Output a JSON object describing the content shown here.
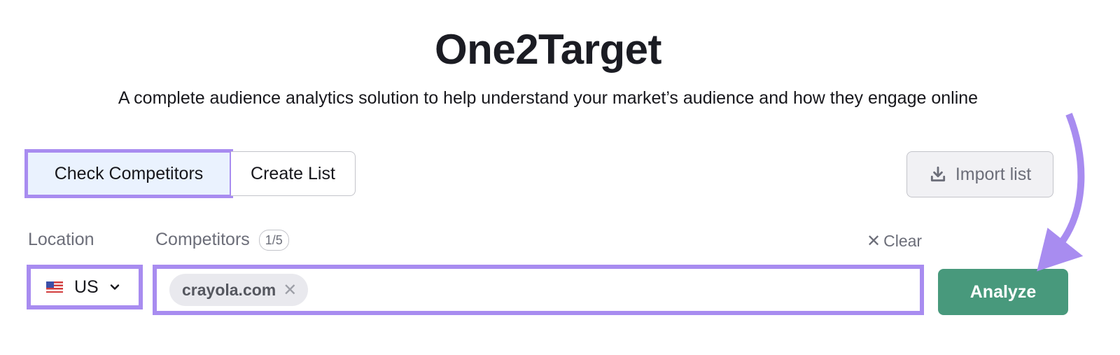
{
  "header": {
    "title": "One2Target",
    "subtitle": "A complete audience analytics solution to help understand your market’s audience and how they engage online"
  },
  "tabs": [
    {
      "label": "Check Competitors",
      "active": true
    },
    {
      "label": "Create List",
      "active": false
    }
  ],
  "import_button": {
    "label": "Import list",
    "icon": "download-icon"
  },
  "location": {
    "label": "Location",
    "selected": "US",
    "flag": "us-flag-icon"
  },
  "competitors": {
    "label": "Competitors",
    "count_badge": "1/5",
    "clear_label": "Clear",
    "chips": [
      {
        "label": "crayola.com"
      }
    ],
    "chip_remove_glyph": "✕"
  },
  "analyze_button": {
    "label": "Analyze"
  },
  "annotation": {
    "highlight_color": "#a88cf0",
    "arrow_target": "analyze-button"
  },
  "colors": {
    "accent_green": "#48997c",
    "highlight_purple": "#a88cf0",
    "active_tab_bg": "#eaf2fe"
  }
}
